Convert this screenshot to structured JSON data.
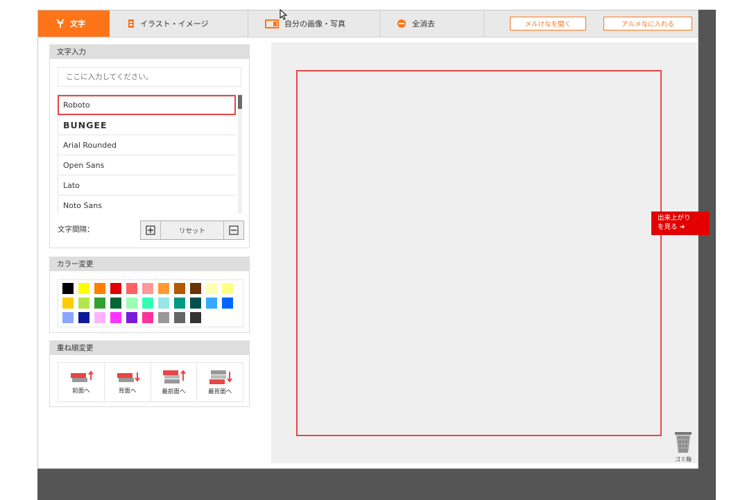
{
  "tabs": {
    "text": "文字",
    "illustration": "イラスト・イメージ",
    "photo": "自分の画像・写真",
    "clear": "全消去"
  },
  "header_buttons": {
    "open": "メルけなを聞く",
    "cart": "アルメなに入れる"
  },
  "text_panel": {
    "title": "文字入力",
    "input_placeholder": "ここに入力してください。",
    "fonts": [
      "Roboto",
      "BUNGEE",
      "Arial Rounded",
      "Open Sans",
      "Lato",
      "Noto Sans"
    ],
    "selected_font": "Roboto",
    "spacing_label": "文字間隔：",
    "reset_label": "リセット"
  },
  "color_panel": {
    "title": "カラー変更",
    "swatches": [
      [
        "#000000",
        "#ffff00",
        "#ff8000",
        "#e00000",
        "#ff6060",
        "#ff9999",
        "#ff9933",
        "#b35900",
        "#6b3300",
        "#ffffb3",
        "#ffff80"
      ],
      [
        "#ffcc00",
        "#b3e64d",
        "#33a033",
        "#006633",
        "#99ffb3",
        "#33ffb3",
        "#99e6e6",
        "#009980",
        "#005050",
        "#33aaff",
        "#0066ff"
      ],
      [
        "#8ca6ff",
        "#0d1a99",
        "#ffb3ff",
        "#ff33ff",
        "#7a1ad9",
        "#ff3399",
        "#999999",
        "#666666",
        "#333333"
      ]
    ]
  },
  "order_panel": {
    "title": "重ね順変更",
    "buttons": [
      "前面へ",
      "背面へ",
      "最前面へ",
      "最背面へ"
    ]
  },
  "canvas": {
    "preview_label_1": "出来上がり",
    "preview_label_2": "を見る ➜",
    "trash_label": "ゴミ箱"
  },
  "colors": {
    "accent": "#ff7418",
    "frame": "#e84545",
    "preview": "#e20000"
  }
}
